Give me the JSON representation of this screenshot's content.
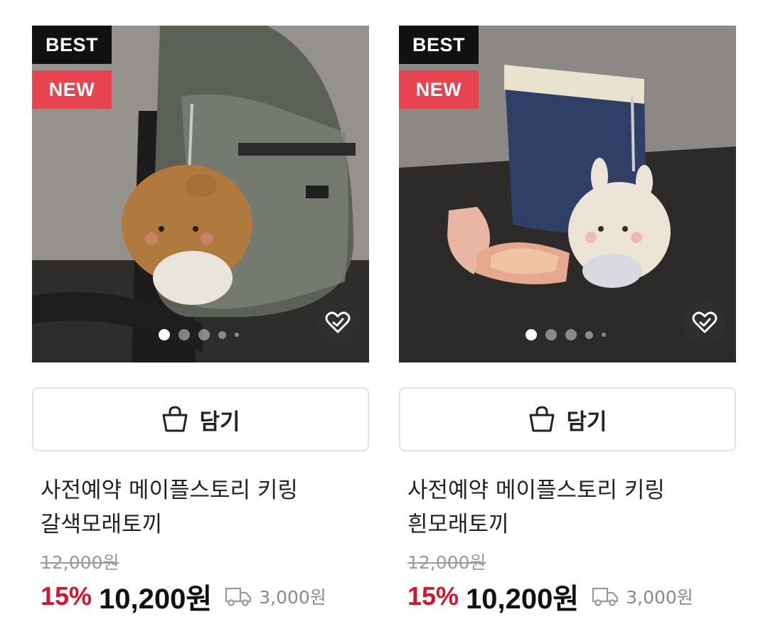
{
  "products": [
    {
      "badges": [
        "BEST",
        "NEW"
      ],
      "wishlist_icon": "heart-icon",
      "carousel": {
        "slide_count": 5,
        "active_index": 0
      },
      "cart_label": "담기",
      "cart_icon": "shopping-bag-icon",
      "title_line1": "사전예약 메이플스토리 키링",
      "title_line2": "갈색모래토끼",
      "original_price": "12,000원",
      "discount": "15%",
      "price": "10,200원",
      "shipping_icon": "delivery-truck-icon",
      "shipping_fee": "3,000원"
    },
    {
      "badges": [
        "BEST",
        "NEW"
      ],
      "wishlist_icon": "heart-icon",
      "carousel": {
        "slide_count": 5,
        "active_index": 0
      },
      "cart_label": "담기",
      "cart_icon": "shopping-bag-icon",
      "title_line1": "사전예약 메이플스토리 키링",
      "title_line2": "흰모래토끼",
      "original_price": "12,000원",
      "discount": "15%",
      "price": "10,200원",
      "shipping_icon": "delivery-truck-icon",
      "shipping_fee": "3,000원"
    }
  ],
  "colors": {
    "new_badge": "#e8444f",
    "best_badge": "#111111",
    "discount": "#d7142c"
  }
}
